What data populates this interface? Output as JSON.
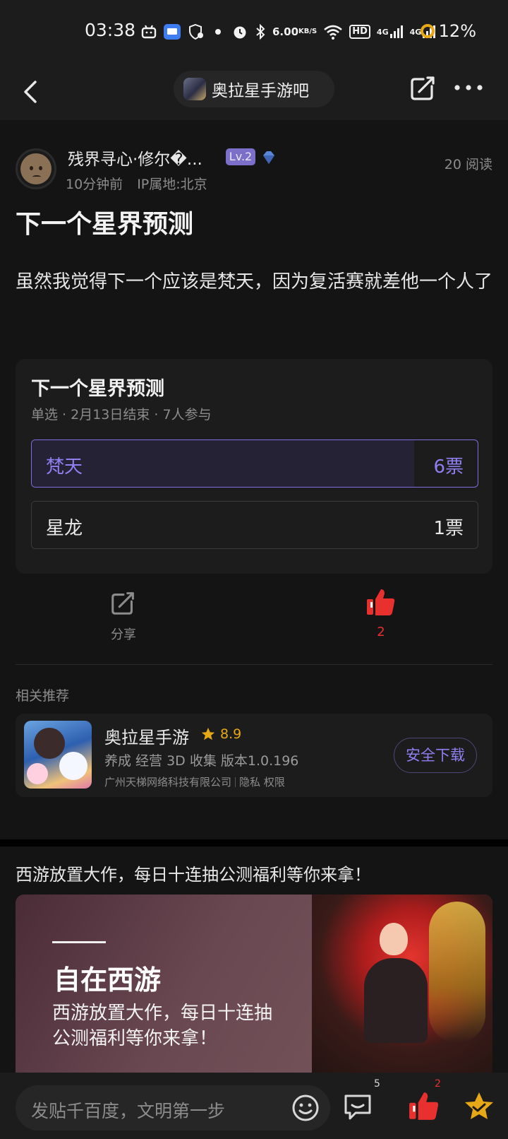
{
  "status_bar": {
    "time": "03:38",
    "net_speed_value": "6.00",
    "net_speed_unit": "KB/S",
    "hd_label": "HD",
    "sim1_label": "4G",
    "sim2_label": "4G",
    "battery": "12%"
  },
  "nav": {
    "forum_name": "奥拉星手游吧"
  },
  "post": {
    "author": "残界寻心·修尔�...",
    "level": "Lv.2",
    "time_ago": "10分钟前",
    "ip": "IP属地:北京",
    "reads": "20 阅读",
    "title": "下一个星界预测",
    "body": "虽然我觉得下一个应该是梵天，因为复活赛就差他一个人了"
  },
  "poll": {
    "title": "下一个星界预测",
    "meta": "单选 · 2月13日结束 · 7人参与",
    "options": [
      {
        "label": "梵天",
        "votes": "6票",
        "fraction": 0.857,
        "selected": true
      },
      {
        "label": "星龙",
        "votes": "1票",
        "fraction": 0.143,
        "selected": false
      }
    ]
  },
  "actions": {
    "share_label": "分享",
    "like_count": "2"
  },
  "related": {
    "title": "相关推荐",
    "app_name": "奥拉星手游",
    "rating": "8.9",
    "tags": "养成 经营 3D 收集  版本1.0.196",
    "company": "广州天梯网络科技有限公司",
    "privacy": "隐私",
    "permissions": "权限",
    "download_label": "安全下载"
  },
  "ad": {
    "title": "西游放置大作，每日十连抽公测福利等你来拿！",
    "banner_title": "自在西游",
    "banner_sub": "西游放置大作，每日十连抽公测福利等你来拿！"
  },
  "bottom_bar": {
    "input_placeholder": "发贴千百度，文明第一步",
    "comment_count": "5",
    "like_count": "2"
  },
  "colors": {
    "accent": "#8f7ff0",
    "like_red": "#e8312f",
    "star_gold": "#e6a817",
    "background": "#141414"
  }
}
